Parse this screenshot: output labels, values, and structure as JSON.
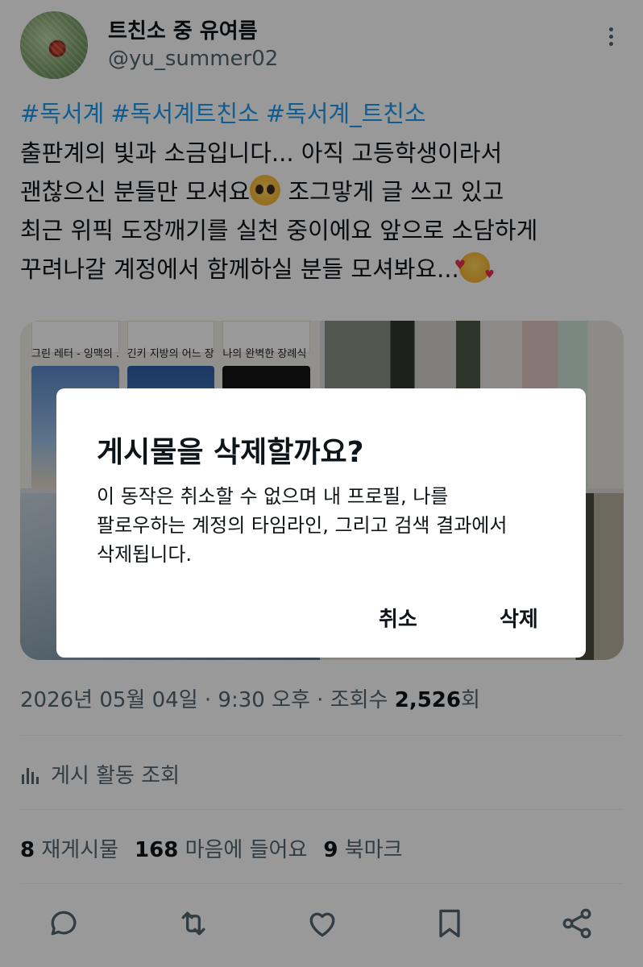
{
  "user": {
    "display_name": "트친소 중 유여름",
    "handle": "@yu_summer02"
  },
  "post": {
    "hashtags": [
      "#독서계",
      "#독서계트친소",
      "#독서계_트친소"
    ],
    "text_lines": [
      "출판계의 빛과 소금입니다... 아직 고등학생이라서",
      "괜찮으신 분들만 모셔요",
      " 조그맣게 글 쓰고 있고",
      "최근 위픽 도장깨기를 실천 중이에요 앞으로 소담하게",
      "꾸려나갈 계정에서 함께하실 분들 모셔봐요..."
    ],
    "emojis": [
      "pleading-face-emoji",
      "smiling-face-with-hearts-emoji"
    ]
  },
  "media": {
    "book_titles": [
      "그린 레터 - 잉맥의 ...",
      "긴키 지방의 어느 장...",
      "나의 완벽한 장례식"
    ]
  },
  "meta": {
    "timestamp": "2026년 05월 04일 · 9:30 오후 · 조회수 ",
    "views": "2,526",
    "views_suffix": "회"
  },
  "analytics": {
    "label": "게시 활동 조회",
    "icon": "bar-chart-icon"
  },
  "stats": {
    "reposts_count": "8",
    "reposts_label": "재게시물",
    "likes_count": "168",
    "likes_label": "마음에 들어요",
    "bookmarks_count": "9",
    "bookmarks_label": "북마크"
  },
  "actions": [
    "reply-icon",
    "repost-icon",
    "like-icon",
    "bookmark-icon",
    "share-icon"
  ],
  "dialog": {
    "title": "게시물을 삭제할까요?",
    "body_lines": [
      "이 동작은 취소할 수 없으며 내 프로필, 나를",
      "팔로우하는 계정의 타임라인, 그리고 검색 결과에서",
      "삭제됩니다."
    ],
    "cancel_label": "취소",
    "delete_label": "삭제"
  },
  "colors": {
    "link": "#1d9bf0",
    "secondary_text": "#536471",
    "primary_text": "#0f1419",
    "overlay": "rgba(0,0,0,0.4)"
  }
}
